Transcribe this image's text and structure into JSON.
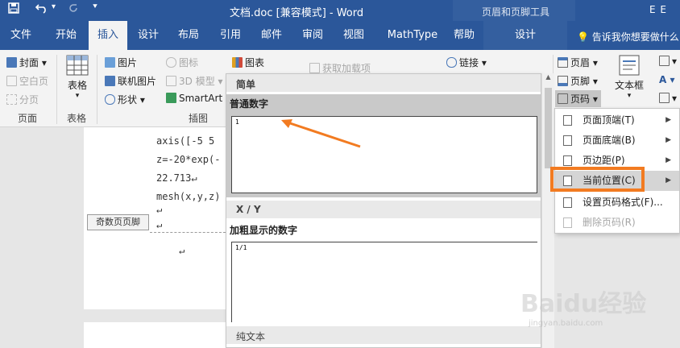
{
  "titlebar": {
    "title": "文档.doc [兼容模式]  -  Word",
    "context_title": "页眉和页脚工具",
    "user": "E E",
    "qa_icons": [
      "save-icon",
      "undo-icon",
      "redo-icon",
      "customize-icon"
    ]
  },
  "tabs": [
    "文件",
    "开始",
    "插入",
    "设计",
    "布局",
    "引用",
    "邮件",
    "审阅",
    "视图",
    "MathType",
    "帮助",
    "设计"
  ],
  "active_tab": "插入",
  "tell_me": "告诉我你想要做什么",
  "ribbon": {
    "pages_group": {
      "cover": "封面",
      "blank": "空白页",
      "break": "分页",
      "label": "页面"
    },
    "table_group": {
      "table": "表格",
      "label": "表格"
    },
    "illustrations_group": {
      "pictures": "图片",
      "online_pictures": "联机图片",
      "shapes": "形状",
      "icons": "图标",
      "model3d": "3D 模型",
      "smartart": "SmartArt",
      "chart": "图表",
      "label": "插图"
    },
    "addins": {
      "get_addins": "获取加载项"
    },
    "links": {
      "link": "链接"
    },
    "header_footer": {
      "header": "页眉",
      "footer": "页脚",
      "page_number": "页码"
    },
    "text_group": {
      "textbox": "文本框"
    }
  },
  "document": {
    "code_lines": [
      "axis([-5 5",
      "z=-20*exp(-",
      "22.713↵",
      "mesh(x,y,z)"
    ],
    "return_marks": [
      "↵",
      "↵",
      "↵"
    ],
    "footer_tag": "奇数页页脚"
  },
  "gallery": {
    "section_simple": "简单",
    "item_plain": "普通数字",
    "preview_plain": "1",
    "section_xy": "X / Y",
    "item_bold": "加粗显示的数字",
    "preview_bold": "1/1",
    "section_plaintext": "纯文本"
  },
  "submenu": {
    "items": [
      {
        "label": "页面顶端(T)",
        "arrow": true,
        "disabled": false
      },
      {
        "label": "页面底端(B)",
        "arrow": true,
        "disabled": false
      },
      {
        "label": "页边距(P)",
        "arrow": true,
        "disabled": false
      },
      {
        "label": "当前位置(C)",
        "arrow": true,
        "disabled": false
      },
      {
        "label": "设置页码格式(F)...",
        "arrow": false,
        "disabled": false
      },
      {
        "label": "删除页码(R)",
        "arrow": false,
        "disabled": true
      }
    ]
  },
  "colors": {
    "brand": "#2b579a",
    "annotation": "#f27b21"
  },
  "watermark": {
    "main": "Baidu经验",
    "sub": "jingyan.baidu.com"
  }
}
